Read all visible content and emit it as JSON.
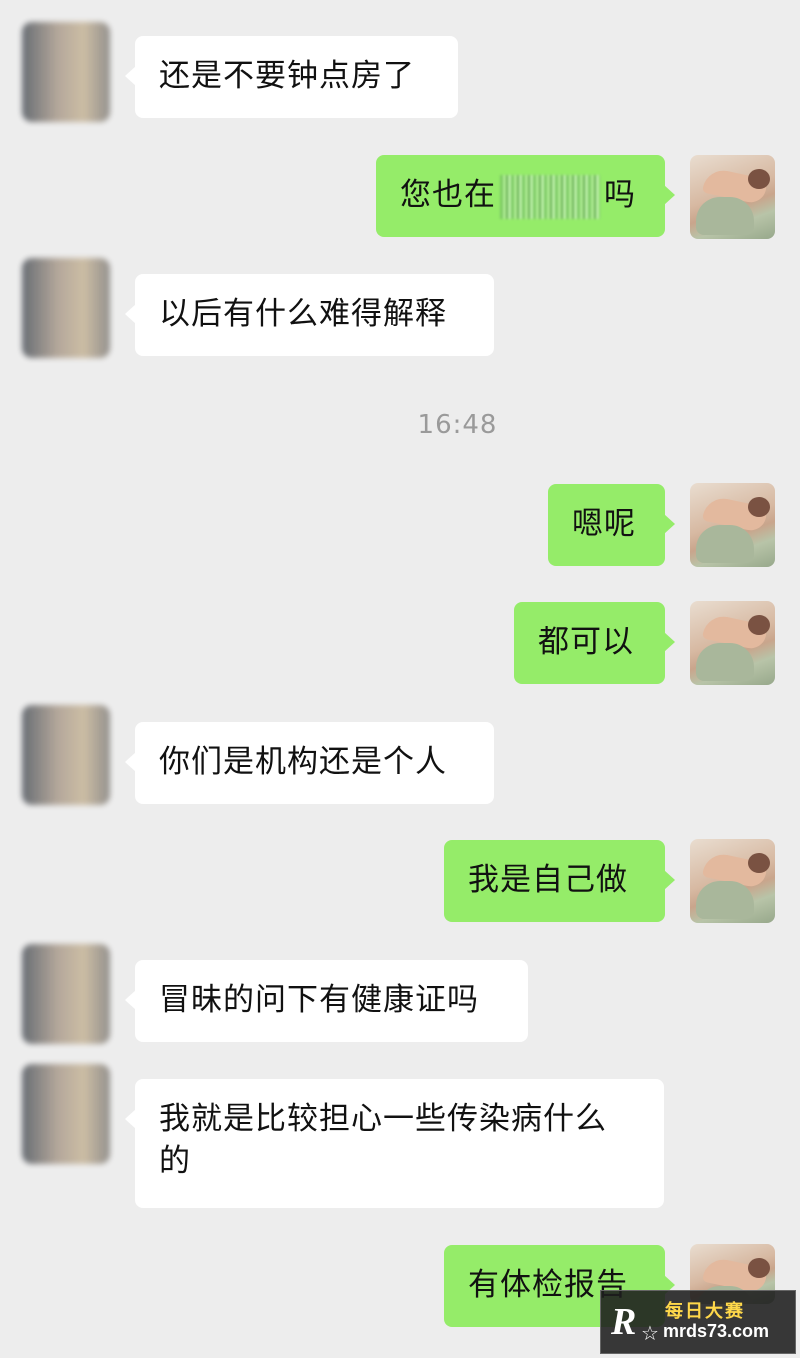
{
  "messages": [
    {
      "side": "in",
      "text": "还是不要钟点房了"
    },
    {
      "side": "out",
      "text_before": "您也在",
      "text_after": "吗"
    },
    {
      "side": "in",
      "text": "以后有什么难得解释"
    },
    {
      "side": "out",
      "text": "嗯呢"
    },
    {
      "side": "out",
      "text": "都可以"
    },
    {
      "side": "in",
      "text": "你们是机构还是个人"
    },
    {
      "side": "out",
      "text": "我是自己做"
    },
    {
      "side": "in",
      "text": "冒昧的问下有健康证吗"
    },
    {
      "side": "in",
      "line1": "我就是比较担心一些传染病什么",
      "line2": "的"
    },
    {
      "side": "out",
      "text": "有体检报告"
    }
  ],
  "timestamp": "16:48",
  "watermark": {
    "logo": "R",
    "name": "每日大赛",
    "url": "mrds73.com"
  },
  "colors": {
    "background": "#ededed",
    "incoming_bubble": "#ffffff",
    "outgoing_bubble": "#95ec69",
    "timestamp": "#9a9a9a"
  }
}
